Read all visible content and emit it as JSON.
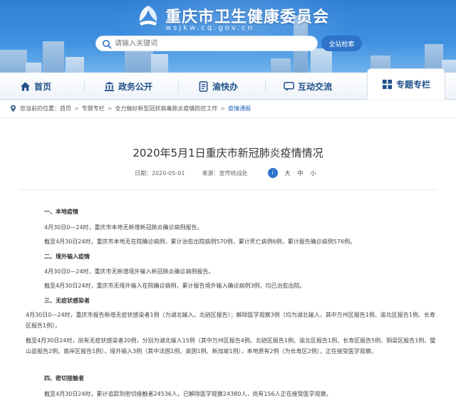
{
  "header": {
    "site_title": "重庆市卫生健康委员会",
    "site_domain": "wsjkw.cq.gov.cn",
    "search_placeholder": "请输入关键词",
    "search_button": "全站检索",
    "colors": {
      "banner": "#3e90e0",
      "accent": "#2e73c9"
    }
  },
  "nav": {
    "items": [
      {
        "label": "首页",
        "icon": "home-icon"
      },
      {
        "label": "政务公开",
        "icon": "building-icon"
      },
      {
        "label": "渝快办",
        "icon": "document-icon"
      },
      {
        "label": "互动交流",
        "icon": "chat-icon"
      },
      {
        "label": "专题专栏",
        "icon": "grid-icon"
      }
    ],
    "active": "专题专栏"
  },
  "breadcrumb": {
    "prefix": "您当前的位置：",
    "items": [
      "首页",
      "专题专栏",
      "全力做好新型冠状病毒肺炎疫情防控工作",
      "疫情通报"
    ]
  },
  "article": {
    "title": "2020年5月1日重庆市新冠肺炎疫情情况",
    "date_label": "日期：2020-05-01",
    "source_label": "来源：宣传统战处",
    "share_icon_text": "i",
    "font_sizes": [
      "大",
      "中",
      "小"
    ]
  },
  "content": {
    "s1_title": "一、本地疫情",
    "s1_p1": "4月30日0—24时，重庆市本地无新增新冠肺炎确诊病例报告。",
    "s1_p2": "截至4月30日24时，重庆市本地无在院确诊病例，累计治愈出院病例570例，累计死亡病例6例，累计报告确诊病例576例。",
    "s2_title": "二、境外输入疫情",
    "s2_p1": "4月30日0—24时，重庆市无新增境外输入新冠肺炎确诊病例报告。",
    "s2_p2": "截至4月30日24时，重庆市无境外输入在院确诊病例，累计报告境外输入确诊病例3例，均已治愈出院。",
    "s3_title": "三、无症状感染者",
    "s3_p1": "4月30日0—24时，重庆市报告新增无症状感染者1例（为湖北输入，北碚区报告）；解除医学观察3例（均为湖北输入，其中万州区报告1例、渝北区报告1例、长寿区报告1例）。",
    "s3_p2": "截至4月30日24时，尚有无症状感染者20例，分别为湖北输入15例（其中万州区报告4例、北碚区报告1例、渝北区报告1例、长寿区报告5例、铜梁区报告1例、璧山县报告2例、南岸区报告1例），境外输入3例（其中法国1例、英国1例、新加坡1例），本地原有2例（为长寿区2例），正在接受医学观察。",
    "s4_title": "四、密切接触者",
    "s4_p1": "截至4月30日24时，累计追踪到密切接触者24536人，已解除医学观察24380人，尚有156人正在接受医学观察。"
  }
}
